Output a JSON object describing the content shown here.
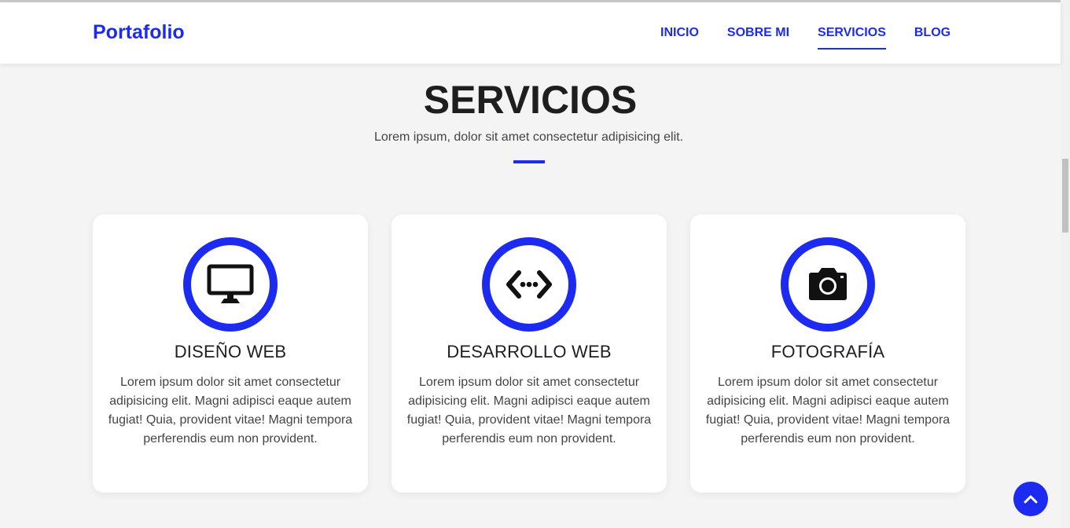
{
  "header": {
    "brand": "Portafolio",
    "nav": [
      "INICIO",
      "SOBRE MI",
      "SERVICIOS",
      "BLOG"
    ],
    "active_nav": "SERVICIOS"
  },
  "section": {
    "title": "SERVICIOS",
    "subtitle": "Lorem ipsum, dolor sit amet consectetur adipisicing elit."
  },
  "services": [
    {
      "icon": "monitor-icon",
      "title": "DISEÑO WEB",
      "text": "Lorem ipsum dolor sit amet consectetur adipisicing elit. Magni adipisci eaque autem fugiat! Quia, provident vitae! Magni tempora perferendis eum non provident."
    },
    {
      "icon": "code-icon",
      "title": "DESARROLLO WEB",
      "text": "Lorem ipsum dolor sit amet consectetur adipisicing elit. Magni adipisci eaque autem fugiat! Quia, provident vitae! Magni tempora perferendis eum non provident."
    },
    {
      "icon": "camera-icon",
      "title": "FOTOGRAFÍA",
      "text": "Lorem ipsum dolor sit amet consectetur adipisicing elit. Magni adipisci eaque autem fugiat! Quia, provident vitae! Magni tempora perferendis eum non provident."
    }
  ],
  "scroll_top_icon": "chevron-up-icon",
  "colors": {
    "accent": "#1d2bf0",
    "background": "#f4f4f4",
    "card": "#ffffff",
    "text_dark": "#1e1e1e",
    "text_body": "#444444"
  }
}
